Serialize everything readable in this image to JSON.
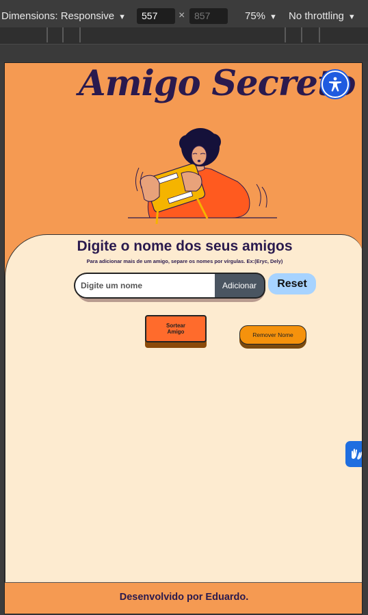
{
  "devtools": {
    "dimensions_label": "Dimensions: Responsive",
    "width_value": "557",
    "height_placeholder": "857",
    "times_sign": "×",
    "zoom_label": "75%",
    "throttling_label": "No throttling",
    "dropdown_icon": "chevron-down-icon"
  },
  "page": {
    "title": "Amigo Secreto",
    "accessibility_icon": "accessibility-person-icon",
    "illustration": "person-holding-tablet-illustration",
    "card": {
      "heading": "Digite o nome dos seus amigos",
      "hint": "Para adicionar mais de um amigo, separe os nomes por vírgulas. Ex:(Eryc, Dely)",
      "input_placeholder": "Digite um nome",
      "input_value": "",
      "add_label": "Adicionar",
      "reset_label": "Reset",
      "draw_label": "Sortear Amigo",
      "remove_label": "Remover Nome"
    },
    "vlibras_icon": "sign-language-hands-icon",
    "footer": "Desenvolvido por Eduardo."
  },
  "colors": {
    "page_bg": "#f59a52",
    "card_bg": "#fdebd0",
    "title_color": "#2a1a4e",
    "draw_button": "#ff6b2c",
    "remove_button": "#f5920c",
    "reset_button": "#a7d3ff",
    "add_button": "#4a5561",
    "accessibility_blue": "#1f5be0"
  }
}
